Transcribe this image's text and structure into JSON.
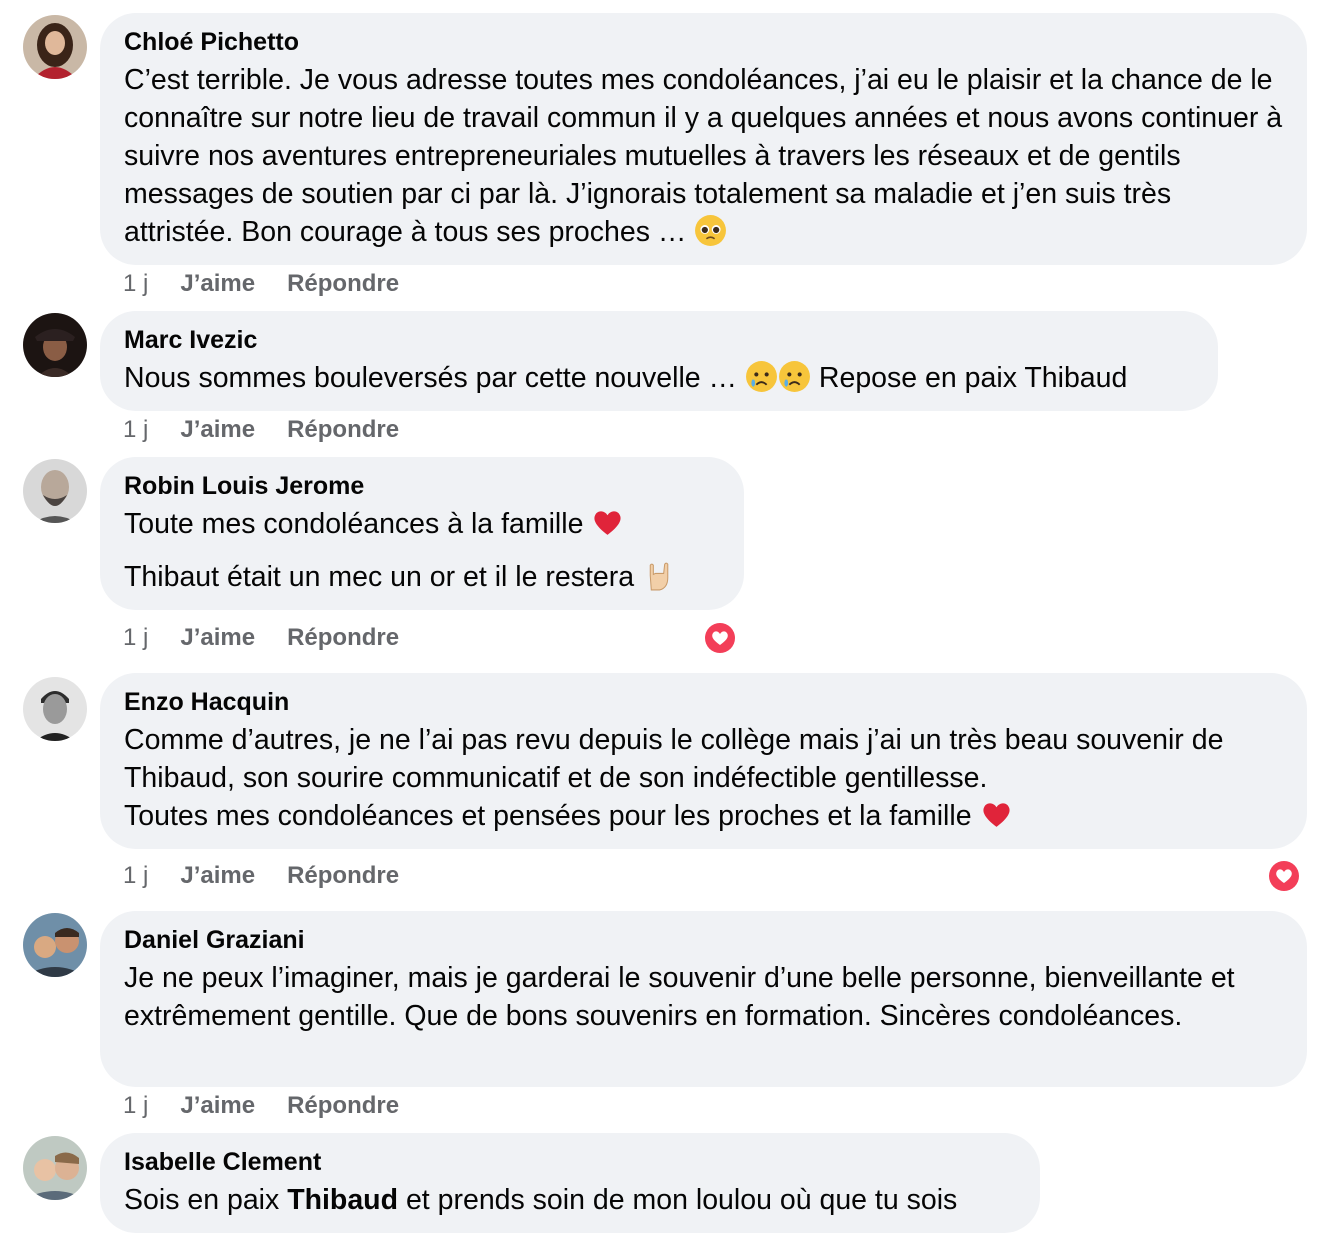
{
  "colors": {
    "bubble": "#f0f2f5",
    "meta": "#65676b",
    "love": "#f33e58"
  },
  "comments": [
    {
      "author": "Chloé Pichetto",
      "avatar_icon": "avatar-woman-dark-hair",
      "text": "C’est terrible. Je vous adresse toutes mes condoléances, j’ai eu le plaisir et la chance de le connaître sur notre lieu de travail commun il y a quelques années et nous avons continuer à suivre nos aventures entrepreneuriales mutuelles à travers les réseaux et de gentils messages de soutien par ci par là. J’ignorais totalement sa maladie et j’en suis très attristée. Bon courage à tous ses proches …",
      "emoji_icon": "pleading-face-emoji",
      "time": "1 j",
      "like": "J’aime",
      "reply": "Répondre"
    },
    {
      "author": "Marc Ivezic",
      "avatar_icon": "avatar-man-hat",
      "text_a": "Nous sommes bouleversés par cette nouvelle …",
      "text_b": "Repose en paix Thibaud",
      "emoji_icon": "sad-tear-face-emoji",
      "time": "1 j",
      "like": "J’aime",
      "reply": "Répondre"
    },
    {
      "author": "Robin Louis Jerome",
      "avatar_icon": "avatar-bald-bearded-man",
      "line1": "Toute mes condoléances à la famille",
      "line2": "Thibaut était un mec un or et il le restera",
      "emoji1_icon": "red-heart-emoji",
      "emoji2_icon": "rock-hand-emoji",
      "reaction_icon": "love-reaction-icon",
      "time": "1 j",
      "like": "J’aime",
      "reply": "Répondre"
    },
    {
      "author": "Enzo Hacquin",
      "avatar_icon": "avatar-man-bw",
      "text1": "Comme d’autres, je ne l’ai pas revu depuis le collège mais j’ai un très beau souvenir de Thibaud, son sourire communicatif et de son indéfectible gentillesse.",
      "text2": "Toutes mes condoléances et pensées pour les proches et la famille",
      "emoji_icon": "red-heart-emoji",
      "reaction_icon": "love-reaction-icon",
      "time": "1 j",
      "like": "J’aime",
      "reply": "Répondre"
    },
    {
      "author": "Daniel Graziani",
      "avatar_icon": "avatar-family-photo",
      "text": "Je ne peux l’imaginer, mais je garderai le souvenir d’une belle personne, bienveillante et extrêmement gentille. Que de bons souvenirs en formation. Sincères condoléances.",
      "time": "1 j",
      "like": "J’aime",
      "reply": "Répondre"
    },
    {
      "author": "Isabelle Clement",
      "avatar_icon": "avatar-women-selfie",
      "text_pre": "Sois en paix",
      "mention": "Thibaud",
      "text_post": "et prends soin de mon loulou où que tu sois"
    }
  ]
}
